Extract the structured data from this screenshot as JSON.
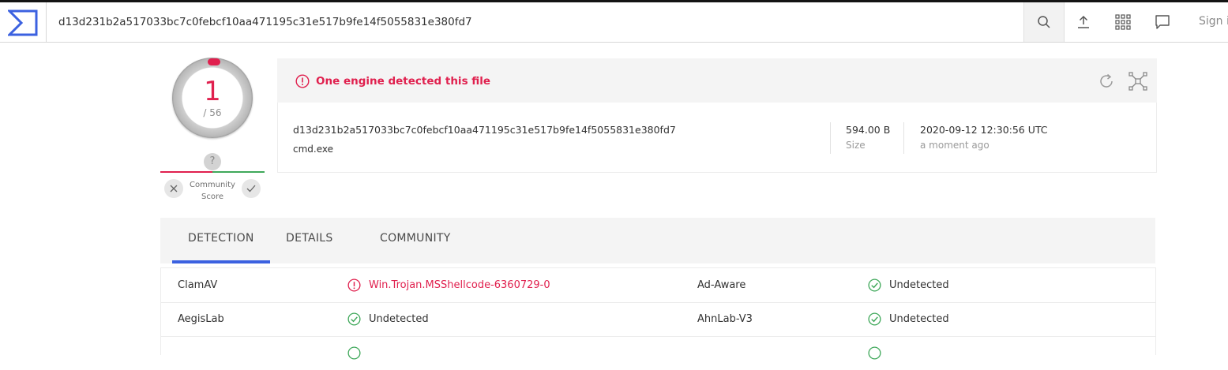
{
  "header": {
    "search_value": "d13d231b2a517033bc7c0febcf10aa471195c31e517b9fe14f5055831e380fd7",
    "signin_label": "Sign in",
    "icons": [
      "virustotal-logo-icon",
      "search-icon",
      "upload-icon",
      "apps-grid-icon",
      "chat-icon"
    ]
  },
  "score": {
    "detections": "1",
    "total": "/ 56",
    "community_unknown": "?",
    "community_label_line1": "Community",
    "community_label_line2": "Score"
  },
  "summary": {
    "alert_text": "One engine detected this file",
    "hash": "d13d231b2a517033bc7c0febcf10aa471195c31e517b9fe14f5055831e380fd7",
    "file_name": "cmd.exe",
    "size_value": "594.00 B",
    "size_label": "Size",
    "date_value": "2020-09-12 12:30:56 UTC",
    "date_relative": "a moment ago"
  },
  "tabs": [
    {
      "label": "DETECTION",
      "active": true
    },
    {
      "label": "DETAILS",
      "active": false
    },
    {
      "label": "COMMUNITY",
      "active": false
    }
  ],
  "results": [
    {
      "engine_a": "ClamAV",
      "result_a": "Win.Trojan.MSShellcode-6360729-0",
      "status_a": "malicious",
      "engine_b": "Ad-Aware",
      "result_b": "Undetected",
      "status_b": "undetected"
    },
    {
      "engine_a": "AegisLab",
      "result_a": "Undetected",
      "status_a": "undetected",
      "engine_b": "AhnLab-V3",
      "result_b": "Undetected",
      "status_b": "undetected"
    }
  ],
  "colors": {
    "malicious": "#e0204e",
    "undetected": "#3fa85a",
    "accent": "#3b61e0"
  }
}
